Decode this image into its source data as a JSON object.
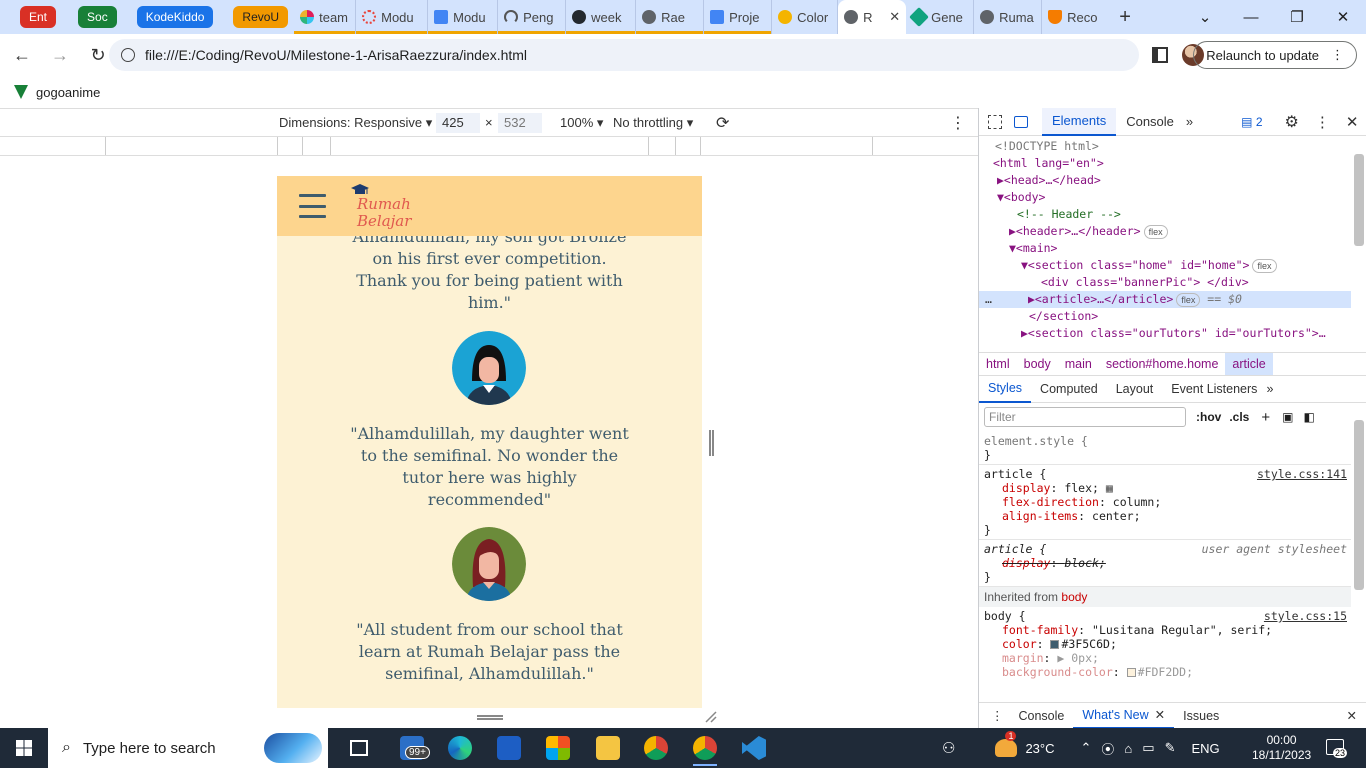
{
  "tabstrip": {
    "groups": [
      {
        "label": "Ent",
        "color": "#d93025"
      },
      {
        "label": "Soc",
        "color": "#188038"
      },
      {
        "label": "KodeKiddo",
        "color": "#1a73e8"
      },
      {
        "label": "RevoU",
        "color": "#f29900"
      }
    ],
    "tabs": [
      {
        "label": "team",
        "icon_color": "#e01e5a"
      },
      {
        "label": "Modu",
        "icon_color": "#e8453c"
      },
      {
        "label": "Modu",
        "icon_color": "#4285f4"
      },
      {
        "label": "Peng",
        "icon_color": "#555555"
      },
      {
        "label": "week",
        "icon_color": "#24292f"
      },
      {
        "label": "Rae",
        "icon_color": "#5f6368"
      },
      {
        "label": "Proje",
        "icon_color": "#4285f4"
      },
      {
        "label": "Color",
        "icon_color": "#f4b400"
      },
      {
        "label": "R",
        "icon_color": "#5f6368",
        "active": true
      },
      {
        "label": "Gene",
        "icon_color": "#10a37f"
      },
      {
        "label": "Ruma",
        "icon_color": "#5f6368"
      },
      {
        "label": "Reco",
        "icon_color": "#f57c00"
      }
    ],
    "new_tab": "+"
  },
  "toolbar": {
    "url": "file:///E:/Coding/RevoU/Milestone-1-ArisaRaezzura/index.html",
    "relaunch_label": "Relaunch to update"
  },
  "bookmarks": [
    {
      "label": "gogoanime",
      "icon_color": "#188038"
    }
  ],
  "device_toolbar": {
    "dimensions_label": "Dimensions: Responsive",
    "width": "425",
    "times": "×",
    "height": "532",
    "zoom": "100%",
    "throttling": "No throttling"
  },
  "page": {
    "brand_line1": "Rumah",
    "brand_line2": "Belajar",
    "colors": {
      "header_bg": "#fdd58e",
      "page_bg": "#fdf2d4",
      "text": "#3f5c6d",
      "brand": "#e0594f"
    },
    "testimonials": [
      {
        "text": "Alhamdulillah, my son got Bronze on his first ever competition. Thank you for being patient with him.\"",
        "avatar": null
      },
      {
        "text": "\"Alhamdulillah, my daughter went to the semifinal. No wonder the tutor here was highly recommended\"",
        "avatar": "girl-black-hair"
      },
      {
        "text": "\"All student from our school that learn at Rumah Belajar pass the semifinal, Alhamdulillah.\"",
        "avatar": "woman-red-hair"
      }
    ]
  },
  "devtools": {
    "tabs": [
      "Elements",
      "Console"
    ],
    "active_tab": "Elements",
    "issues_count": "2",
    "dom": [
      {
        "indent": 1,
        "html": "<!DOCTYPE html>",
        "kind": "doctype"
      },
      {
        "indent": 1,
        "html": "<html lang=\"en\">",
        "kind": "html"
      },
      {
        "indent": 2,
        "html": "▶<head>…</head>",
        "kind": "head"
      },
      {
        "indent": 2,
        "html": "▼<body>",
        "kind": "body"
      },
      {
        "indent": 3,
        "html": "<!-- Header -->",
        "kind": "comment"
      },
      {
        "indent": 3,
        "html": "▶<header>…</header>",
        "kind": "header",
        "pill": "flex"
      },
      {
        "indent": 3,
        "html": "▼<main>",
        "kind": "main"
      },
      {
        "indent": 4,
        "html": "▼<section class=\"home\" id=\"home\">",
        "kind": "section",
        "pill": "flex"
      },
      {
        "indent": 5,
        "html": "<div class=\"bannerPic\"> </div>",
        "kind": "div"
      },
      {
        "indent": 5,
        "html": "▶<article>…</article>",
        "kind": "article",
        "pill": "flex",
        "suffix": "== $0",
        "selected": true
      },
      {
        "indent": 4,
        "html": "</section>",
        "kind": "close"
      },
      {
        "indent": 4,
        "html": "▶<section class=\"ourTutors\" id=\"ourTutors\">…",
        "kind": "section2"
      }
    ],
    "breadcrumbs": [
      "html",
      "body",
      "main",
      "section#home.home",
      "article"
    ],
    "styles_tabs": [
      "Styles",
      "Computed",
      "Layout",
      "Event Listeners"
    ],
    "filter_placeholder": "Filter",
    "hov": ":hov",
    "cls": ".cls",
    "rules": {
      "element_style": "element.style {",
      "article_selector": "article {",
      "article_source": "style.css:141",
      "article_props": [
        {
          "name": "display",
          "value": "flex;"
        },
        {
          "name": "flex-direction",
          "value": "column;"
        },
        {
          "name": "align-items",
          "value": "center;"
        }
      ],
      "ua_selector": "article {",
      "ua_source": "user agent stylesheet",
      "ua_prop": {
        "name": "display",
        "value": "block;"
      },
      "inherited_label": "Inherited from",
      "inherited_from": "body",
      "body_selector": "body {",
      "body_source": "style.css:15",
      "body_props": [
        {
          "name": "font-family",
          "value": "\"Lusitana Regular\", serif;"
        },
        {
          "name": "color",
          "value": "#3F5C6D;",
          "swatch": "#3F5C6D"
        },
        {
          "name": "margin",
          "value": "▶ 0px;",
          "dim": true
        },
        {
          "name": "background-color",
          "value": "#FDF2DD;",
          "swatch": "#FDF2DD",
          "dim": true
        }
      ],
      "close_brace": "}"
    },
    "drawer": {
      "console": "Console",
      "whats_new": "What's New",
      "issues": "Issues"
    }
  },
  "taskbar": {
    "search_placeholder": "Type here to search",
    "mail_badge": "99+",
    "temperature": "23°C",
    "language": "ENG",
    "time": "00:00",
    "date": "18/11/2023",
    "notification_count": "23",
    "weather_badge": "1"
  }
}
